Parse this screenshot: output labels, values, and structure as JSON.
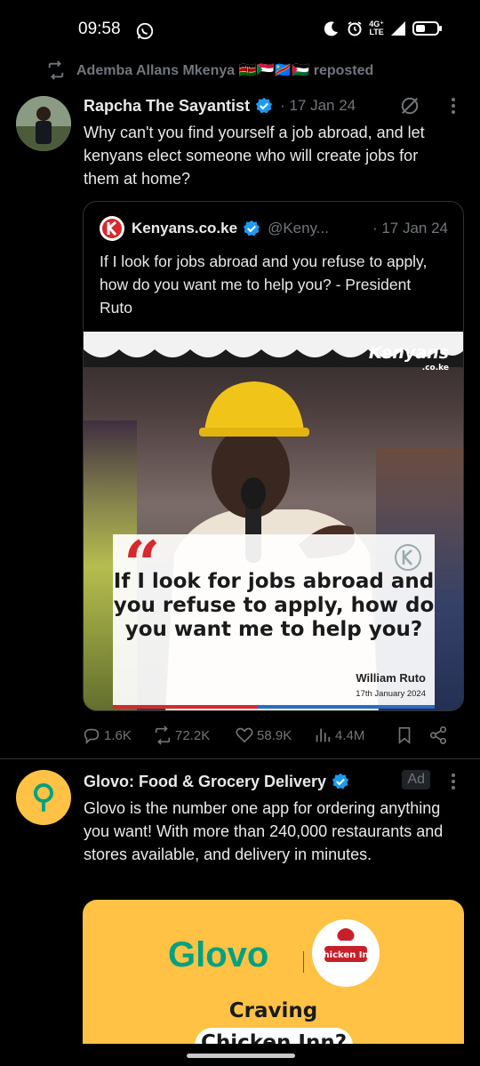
{
  "status_bar": {
    "time": "09:58",
    "network_top": "4G⁺",
    "network_bottom": "LTE"
  },
  "repost": {
    "label": "Ademba Allans Mkenya 🇰🇪🇸🇩🇨🇩🇵🇸 reposted"
  },
  "tweet1": {
    "name": "Rapcha The Sayantist",
    "date": "· 17 Jan 24",
    "text": "Why can't you find yourself a job abroad, and let kenyans elect someone who will create jobs for them at home?",
    "quote": {
      "name": "Kenyans.co.ke",
      "handle": "@Keny...",
      "date": "· 17 Jan 24",
      "text": "If I look for jobs abroad and you refuse to apply, how do you want me to help you? - President Ruto",
      "image": {
        "watermark": "Kenyans",
        "watermark_sub": ".co.ke",
        "quote_mark": "“",
        "quote_text": "If I look for jobs abroad and you refuse to apply, how do you want me to help you?",
        "author": "William Ruto",
        "date": "17th January 2024"
      }
    },
    "actions": {
      "replies": "1.6K",
      "reposts": "72.2K",
      "likes": "58.9K",
      "views": "4.4M"
    }
  },
  "tweet2": {
    "name": "Glovo: Food & Grocery Delivery",
    "ad_label": "Ad",
    "text": "Glovo is the number one app for ordering anything you want! With more than 240,000 restaurants and stores available, and delivery in minutes.",
    "card": {
      "brand": "Glovo",
      "partner": "Chicken Inn",
      "headline": "Craving",
      "pill": "Chicken Inn?"
    }
  },
  "colors": {
    "accent": "#1d9bf0",
    "glovo_yellow": "#ffc244",
    "glovo_green": "#00a082",
    "muted": "#71767b"
  }
}
